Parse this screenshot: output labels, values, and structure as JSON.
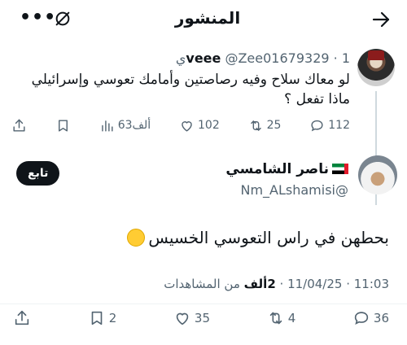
{
  "header": {
    "title": "المنشور",
    "menu_label": "•••"
  },
  "quoted_post": {
    "display_name": "veee",
    "handle_meta": "@Zee01679329 · 1ي",
    "text": "لو معاك سلاح وفيه رصاصتين وأمامك تعوسي وإسرائيلي ماذا تفعل ؟",
    "actions": {
      "replies": "112",
      "reposts": "25",
      "likes": "102",
      "views": "63ألف"
    }
  },
  "reply_post": {
    "display_name": "ناصر الشامسي",
    "handle": "@Nm_ALshamisi",
    "follow_label": "تابع",
    "text": "بحطهن في راس التعوسي الخسيس",
    "timestamp": "11:03 · 11/04/25 ·",
    "views_count": "2ألف",
    "views_label": "من المشاهدات",
    "actions": {
      "replies": "36",
      "reposts": "4",
      "likes": "35",
      "bookmarks": "2"
    }
  },
  "colors": {
    "text_primary": "#0f1419",
    "text_secondary": "#536471",
    "divider": "#eff3f4",
    "thread_line": "#cfd9de"
  },
  "icons": {
    "back": "arrow-right-icon",
    "mute": "mute-icon",
    "reply": "speech-bubble-icon",
    "repost": "repost-icon",
    "like": "heart-icon",
    "views": "bar-chart-icon",
    "bookmark": "bookmark-icon",
    "share": "share-icon"
  }
}
